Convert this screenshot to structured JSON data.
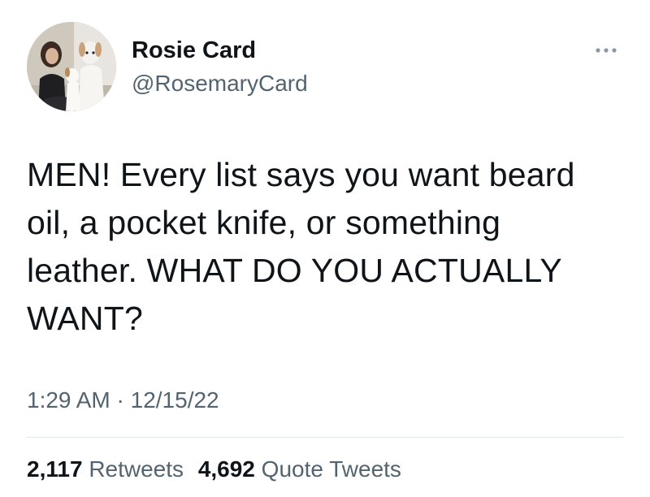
{
  "author": {
    "display_name": "Rosie Card",
    "handle": "@RosemaryCard"
  },
  "tweet": {
    "text_lines": [
      "MEN! Every list says you want beard",
      "oil, a pocket knife, or something",
      "leather. WHAT DO YOU ACTUALLY",
      "WANT?"
    ],
    "time": "1:29 AM",
    "separator": "·",
    "date": "12/15/22"
  },
  "stats": {
    "retweets_count": "2,117",
    "retweets_label": "Retweets",
    "quotes_count": "4,692",
    "quotes_label": "Quote Tweets"
  },
  "icons": {
    "more": "more-horizontal-icon"
  },
  "colors": {
    "primary_text": "#0f1419",
    "secondary_text": "#536471",
    "divider": "#e1e6ea"
  }
}
